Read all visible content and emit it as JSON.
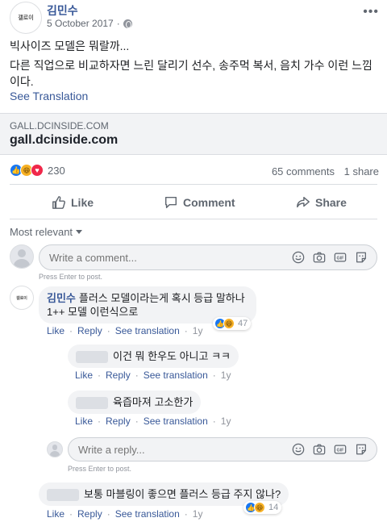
{
  "post": {
    "author": "김민수",
    "avatar_text": "갤로이",
    "date": "5 October 2017",
    "line1": "빅사이즈 모델은 뭐랄까...",
    "line2": "다른 직업으로 비교하자면 느린 달리기 선수, 송주먹 복서, 음치 가수 이런 느낌이다.",
    "see_translation": "See Translation",
    "link": {
      "domain": "GALL.DCINSIDE.COM",
      "title": "gall.dcinside.com"
    },
    "reaction_count": "230",
    "comments_count": "65 comments",
    "shares_count": "1 share"
  },
  "actions": {
    "like": "Like",
    "comment": "Comment",
    "share": "Share"
  },
  "sort_label": "Most relevant",
  "composer": {
    "placeholder": "Write a comment...",
    "hint": "Press Enter to post."
  },
  "comments": [
    {
      "author": "김민수",
      "avatar_text": "갤로이",
      "text": "플러스 모델이라는게 혹시 등급 말하나 1++ 모델 이런식으로",
      "reactions": "47",
      "time": "1y"
    },
    {
      "text": "이건 뭐 한우도 아니고 ㅋㅋ",
      "time": "1y"
    },
    {
      "text": "육즙마져 고소한가",
      "time": "1y"
    },
    {
      "text": "보통 마블링이 좋으면 플러스 등급 주지 않나?",
      "reactions": "14",
      "time": "1y"
    }
  ],
  "comment_actions": {
    "like": "Like",
    "reply": "Reply",
    "see_translation": "See translation"
  },
  "reply_composer": {
    "placeholder": "Write a reply...",
    "hint": "Press Enter to post."
  },
  "colors": {
    "link": "#385898",
    "like_blue": "#1877f2",
    "haha_yellow": "#f7b125",
    "love_red": "#f0284a"
  }
}
